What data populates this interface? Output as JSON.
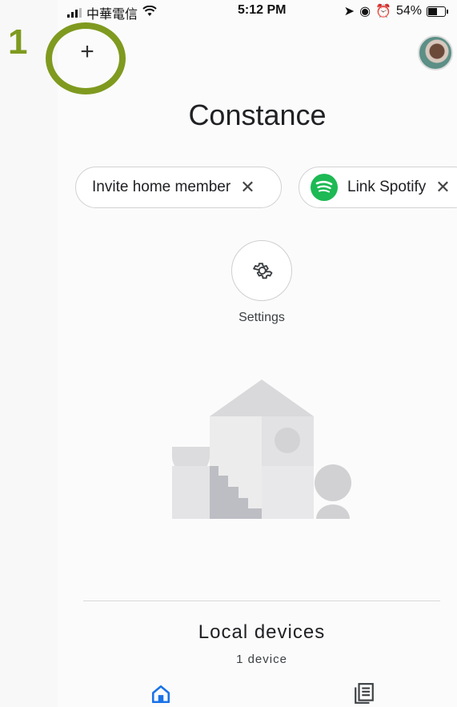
{
  "status_bar": {
    "carrier": "中華電信",
    "time": "5:12 PM",
    "battery": "54%"
  },
  "annotation": {
    "step_number": "1",
    "color": "#7f9a1f"
  },
  "header": {
    "add_icon": "plus-icon",
    "add_symbol": "+",
    "avatar_icon": "profile-avatar"
  },
  "home": {
    "title": "Constance"
  },
  "chips": {
    "invite_label": "Invite home member",
    "spotify_label": "Link Spotify",
    "close_symbol": "✕"
  },
  "settings": {
    "label": "Settings",
    "icon": "gear-icon"
  },
  "local_devices": {
    "title": "Local devices",
    "count": "1 device"
  },
  "bottom_nav": {
    "home_icon": "home-icon",
    "feed_icon": "feed-icon",
    "active_color": "#1a73e8"
  },
  "colors": {
    "spotify_green": "#1db954",
    "text": "#202124"
  }
}
